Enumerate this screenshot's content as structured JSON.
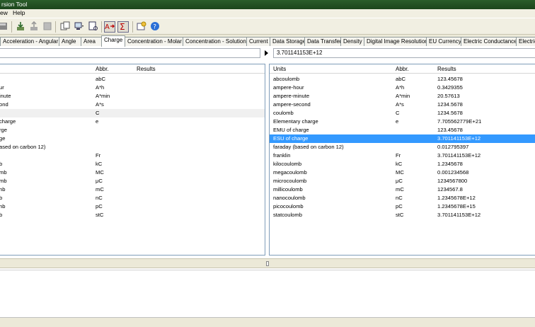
{
  "window": {
    "title_fragment": "rsion Tool"
  },
  "menu": {
    "view": "ew",
    "help": "Help"
  },
  "tabs": [
    "Acceleration - Angular",
    "Angle",
    "Area",
    "Charge",
    "Concentration - Molar",
    "Concentration - Solution",
    "Current",
    "Data Storage",
    "Data Transfer",
    "Density",
    "Digital Image Resolution",
    "EU Currency",
    "Electric Conductance",
    "Electric"
  ],
  "active_tab": "Charge",
  "input": {
    "value": "3.701141153E+12"
  },
  "left": {
    "headers": {
      "abbr": "Abbr.",
      "results": "Results"
    },
    "rows": [
      {
        "unit": "",
        "abbr": "abC"
      },
      {
        "unit": "ur",
        "abbr": "A*h"
      },
      {
        "unit": "inute",
        "abbr": "A*min"
      },
      {
        "unit": "ond",
        "abbr": "A*s"
      },
      {
        "unit": "",
        "abbr": "C"
      },
      {
        "unit": "charge",
        "abbr": "e"
      },
      {
        "unit": "rge",
        "abbr": ""
      },
      {
        "unit": "ge",
        "abbr": ""
      },
      {
        "unit": "ased on carbon 12)",
        "abbr": ""
      },
      {
        "unit": "",
        "abbr": "Fr"
      },
      {
        "unit": "b",
        "abbr": "kC"
      },
      {
        "unit": "mb",
        "abbr": "MC"
      },
      {
        "unit": "mb",
        "abbr": "μC"
      },
      {
        "unit": "nb",
        "abbr": "mC"
      },
      {
        "unit": "b",
        "abbr": "nC"
      },
      {
        "unit": "nb",
        "abbr": "pC"
      },
      {
        "unit": "b",
        "abbr": "stC"
      }
    ]
  },
  "right": {
    "headers": {
      "units": "Units",
      "abbr": "Abbr.",
      "results": "Results"
    },
    "rows": [
      {
        "unit": "abcoulomb",
        "abbr": "abC",
        "result": "123.45678"
      },
      {
        "unit": "ampere-hour",
        "abbr": "A*h",
        "result": "0.3429355"
      },
      {
        "unit": "ampere-minute",
        "abbr": "A*min",
        "result": "20.57613"
      },
      {
        "unit": "ampere-second",
        "abbr": "A*s",
        "result": "1234.5678"
      },
      {
        "unit": "coulomb",
        "abbr": "C",
        "result": "1234.5678"
      },
      {
        "unit": "Elementary charge",
        "abbr": "e",
        "result": "7.705562779E+21"
      },
      {
        "unit": "EMU of charge",
        "abbr": "",
        "result": "123.45678"
      },
      {
        "unit": "ESU of charge",
        "abbr": "",
        "result": "3.701141153E+12"
      },
      {
        "unit": "faraday (based on carbon 12)",
        "abbr": "",
        "result": "0.012795397"
      },
      {
        "unit": "franklin",
        "abbr": "Fr",
        "result": "3.701141153E+12"
      },
      {
        "unit": "kilocoulomb",
        "abbr": "kC",
        "result": "1.2345678"
      },
      {
        "unit": "megacoulomb",
        "abbr": "MC",
        "result": "0.001234568"
      },
      {
        "unit": "microcoulomb",
        "abbr": "μC",
        "result": "1234567800"
      },
      {
        "unit": "millicoulomb",
        "abbr": "mC",
        "result": "1234567.8"
      },
      {
        "unit": "nanocoulomb",
        "abbr": "nC",
        "result": "1.2345678E+12"
      },
      {
        "unit": "picocoulomb",
        "abbr": "pC",
        "result": "1.2345678E+15"
      },
      {
        "unit": "statcoulomb",
        "abbr": "stC",
        "result": "3.701141153E+12"
      }
    ],
    "selected_index": 7
  },
  "colors": {
    "selection": "#3399ff",
    "titlebar": "#1c451c"
  }
}
